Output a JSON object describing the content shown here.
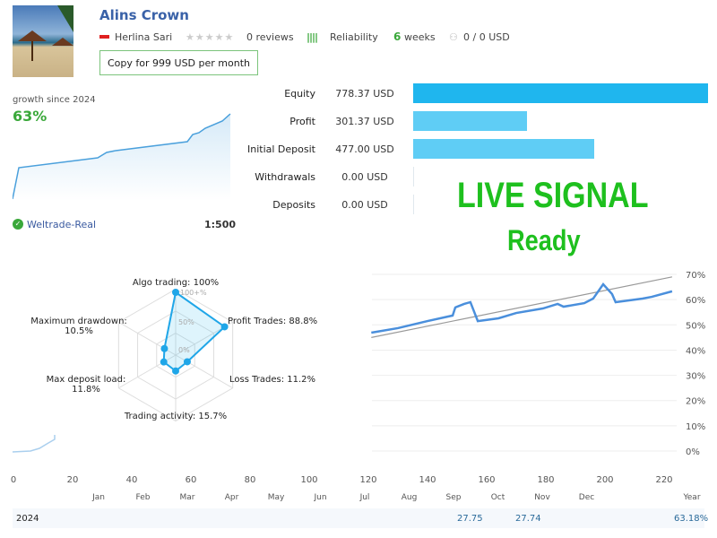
{
  "header": {
    "title": "Alins Crown",
    "author": "Herlina Sari",
    "reviews": "0 reviews",
    "stars": 0,
    "reliability_label": "Reliability",
    "weeks_num": "6",
    "weeks_label": "weeks",
    "subscribers": "0 / 0 USD",
    "copy_button": "Copy for 999 USD per month"
  },
  "growth": {
    "label": "growth since 2024",
    "value": "63%",
    "broker": "Weltrade-Real",
    "leverage": "1:500"
  },
  "stats": [
    {
      "label": "Equity",
      "value": "778.37 USD",
      "amount": 778.37
    },
    {
      "label": "Profit",
      "value": "301.37 USD",
      "amount": 301.37
    },
    {
      "label": "Initial Deposit",
      "value": "477.00 USD",
      "amount": 477.0
    },
    {
      "label": "Withdrawals",
      "value": "0.00 USD",
      "amount": 0
    },
    {
      "label": "Deposits",
      "value": "0.00 USD",
      "amount": 0
    }
  ],
  "colors": {
    "equity": "#1fb6ee",
    "bar_light": "#5fcdf5",
    "accent_green": "#1ec01e",
    "line": "#4a8fdc"
  },
  "overlay": {
    "line1": "LIVE SIGNAL",
    "line2": "Ready"
  },
  "radar": {
    "axes": [
      {
        "label": "Algo trading: 100%",
        "value": 100
      },
      {
        "label": "Profit Trades: 88.8%",
        "value": 88.8
      },
      {
        "label": "Loss Trades: 11.2%",
        "value": 11.2
      },
      {
        "label": "Trading activity: 15.7%",
        "value": 15.7
      },
      {
        "label": "Max deposit load:",
        "label2": "11.8%",
        "value": 11.8
      },
      {
        "label": "Maximum drawdown:",
        "label2": "10.5%",
        "value": 10.5
      }
    ],
    "ring_labels": [
      "100+%",
      "50%",
      "0%"
    ]
  },
  "chart_data": {
    "type": "line",
    "x_ticks": [
      "0",
      "20",
      "40",
      "60",
      "80",
      "100",
      "120",
      "140",
      "160",
      "180",
      "200",
      "220"
    ],
    "y_ticks": [
      "0%",
      "10%",
      "20%",
      "30%",
      "40%",
      "50%",
      "60%",
      "70%"
    ],
    "ylim": [
      0,
      70
    ],
    "xlim": [
      0,
      230
    ],
    "series": [
      {
        "x": [
          121,
          130,
          140,
          148.5,
          149.4,
          152.4,
          154.5,
          157,
          164,
          170,
          179,
          184,
          186,
          193,
          196,
          199.4,
          202.4,
          203.6,
          212.7,
          215.8,
          222.7
        ],
        "y": [
          46.9,
          48.7,
          51.5,
          53.7,
          56.9,
          58.3,
          59.0,
          51.5,
          52.6,
          54.7,
          56.5,
          58.3,
          57.2,
          58.6,
          60.4,
          66.1,
          62.2,
          59.0,
          60.4,
          61.1,
          63.3
        ]
      }
    ],
    "trend": {
      "x": [
        121,
        222.7
      ],
      "y": [
        45,
        69
      ]
    }
  },
  "months": [
    "Jan",
    "Feb",
    "Mar",
    "Apr",
    "May",
    "Jun",
    "Jul",
    "Aug",
    "Sep",
    "Oct",
    "Nov",
    "Dec",
    "Year"
  ],
  "year_row": {
    "year": "2024",
    "sep": "27.75",
    "oct": "27.74",
    "total": "63.18%"
  }
}
